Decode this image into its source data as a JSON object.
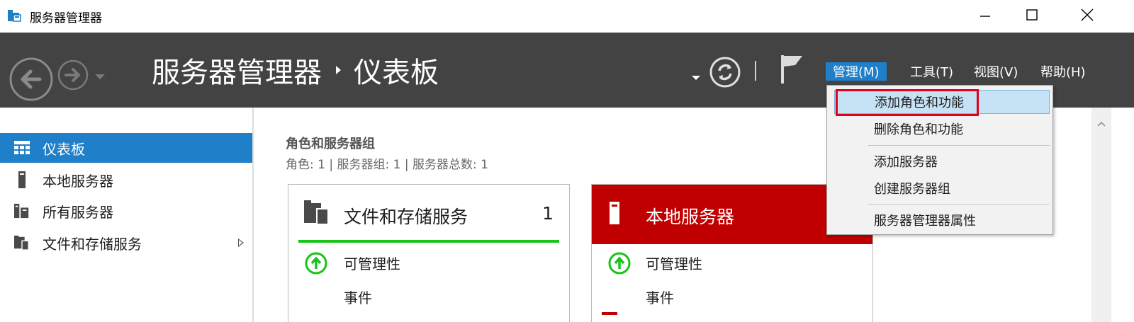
{
  "window": {
    "title": "服务器管理器",
    "minimize_icon": "minimize-icon",
    "maximize_icon": "maximize-icon",
    "close_icon": "close-icon"
  },
  "header": {
    "breadcrumb_root": "服务器管理器",
    "breadcrumb_current": "仪表板",
    "menus": {
      "manage": "管理(M)",
      "tools": "工具(T)",
      "view": "视图(V)",
      "help": "帮助(H)"
    }
  },
  "manage_menu": {
    "items": [
      {
        "label": "添加角色和功能",
        "highlighted": true
      },
      {
        "label": "删除角色和功能"
      },
      {
        "label": "添加服务器"
      },
      {
        "label": "创建服务器组"
      },
      {
        "label": "服务器管理器属性"
      }
    ]
  },
  "sidebar": {
    "items": [
      {
        "label": "仪表板",
        "icon": "dashboard-grid-icon",
        "active": true
      },
      {
        "label": "本地服务器",
        "icon": "server-icon"
      },
      {
        "label": "所有服务器",
        "icon": "servers-icon"
      },
      {
        "label": "文件和存储服务",
        "icon": "file-storage-icon",
        "has_submenu": true
      }
    ]
  },
  "main": {
    "section_title": "角色和服务器组",
    "section_subtitle": "角色: 1 | 服务器组: 1 | 服务器总数: 1",
    "cards": [
      {
        "title": "文件和存储服务",
        "count": "1",
        "rows": [
          "可管理性",
          "事件"
        ]
      },
      {
        "title": "本地服务器",
        "rows": [
          "可管理性",
          "事件"
        ]
      }
    ]
  },
  "colors": {
    "header_bg": "#434343",
    "accent": "#1f7fc8",
    "card_red": "#c00000",
    "status_green": "#18c418",
    "menu_highlight": "#c6e2f5",
    "annotation_red": "#e0001b"
  }
}
